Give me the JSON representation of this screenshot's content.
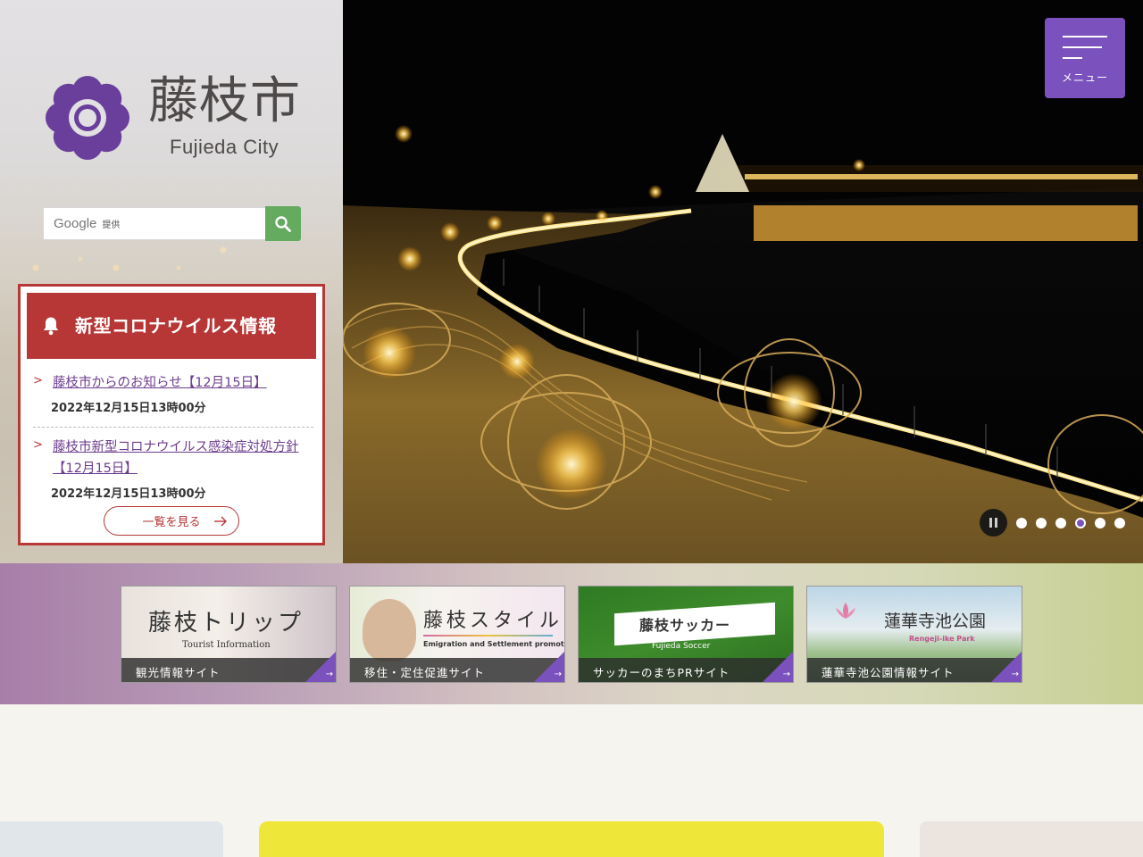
{
  "logo": {
    "name_jp": "藤枝市",
    "name_en": "Fujieda City"
  },
  "search": {
    "brand": "Google",
    "provided": "提供",
    "button_icon": "search-icon"
  },
  "menu": {
    "label": "メニュー",
    "icon": "hamburger-icon"
  },
  "covid": {
    "title": "新型コロナウイルス情報",
    "icon": "bell-icon",
    "items": [
      {
        "label": "藤枝市からのお知らせ【12月15日】",
        "date": "2022年12月15日13時00分"
      },
      {
        "label": "藤枝市新型コロナウイルス感染症対処方針【12月15日】",
        "date": "2022年12月15日13時00分"
      }
    ],
    "list_button": "一覧を見る"
  },
  "slider": {
    "total": 6,
    "active_index": 4,
    "pause_icon": "pause-icon"
  },
  "banners": [
    {
      "title": "藤枝トリップ",
      "subtitle": "Tourist Information",
      "caption": "観光情報サイト"
    },
    {
      "title": "藤枝スタイル",
      "subtitle": "Emigration and Settlement promotion",
      "caption": "移住・定住促進サイト"
    },
    {
      "title": "藤枝サッカー",
      "subtitle": "Fujieda Soccer",
      "caption": "サッカーのまちPRサイト"
    },
    {
      "title": "蓮華寺池公園",
      "subtitle": "Rengeji-ike Park",
      "caption": "蓮華寺池公園情報サイト"
    }
  ],
  "colors": {
    "brand_purple": "#7b52bd",
    "covid_red": "#b73636",
    "search_green": "#64ab5f",
    "logo_purple": "#6a3f9c"
  }
}
